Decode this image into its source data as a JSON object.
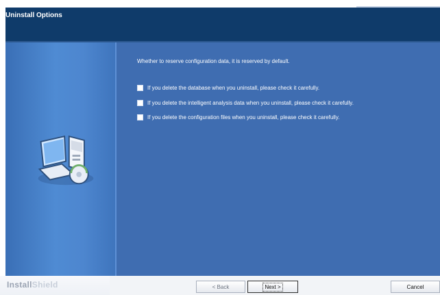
{
  "window": {
    "title": "Uninstall Options"
  },
  "content": {
    "intro": "Whether to reserve configuration data, it is reserved by default.",
    "options": [
      {
        "label": "If you delete the database when you uninstall, please check it carefully.",
        "checked": false
      },
      {
        "label": "If you delete the intelligent analysis data when you uninstall, please check it carefully.",
        "checked": false
      },
      {
        "label": "If you delete the configuration files when you uninstall, please check it carefully.",
        "checked": false
      }
    ]
  },
  "footer": {
    "brand": {
      "part1": "Install",
      "part2": "Shield"
    },
    "buttons": {
      "back": "< Back",
      "next": "Next >",
      "cancel": "Cancel"
    }
  },
  "colors": {
    "header_bg": "#0f3b6a",
    "content_bg": "#3f6db1",
    "left_panel_gradient": "#4f8bd3",
    "text": "#ffffff",
    "footer_bg": "#f2f4f7"
  },
  "icons": {
    "illustration": "computer-illustration-icon"
  }
}
